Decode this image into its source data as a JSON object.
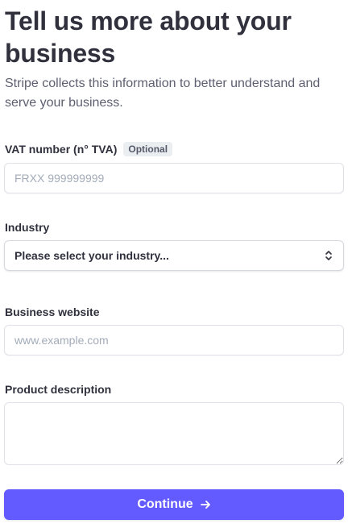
{
  "heading": {
    "title": "Tell us more about your business",
    "subtitle": "Stripe collects this information to better understand and serve your business."
  },
  "form": {
    "vat": {
      "label": "VAT number (n° TVA)",
      "badge": "Optional",
      "placeholder": "FRXX 999999999",
      "value": ""
    },
    "industry": {
      "label": "Industry",
      "selected": "Please select your industry...",
      "icon": "chevron-up-down-icon"
    },
    "website": {
      "label": "Business website",
      "placeholder": "www.example.com",
      "value": ""
    },
    "description": {
      "label": "Product description",
      "value": ""
    }
  },
  "actions": {
    "continue_label": "Continue",
    "continue_icon": "arrow-right-icon"
  },
  "colors": {
    "accent": "#635bff",
    "text": "#30313d",
    "muted": "#5d5f70",
    "border": "#e0e0e6",
    "badge_bg": "#ebeef1"
  }
}
